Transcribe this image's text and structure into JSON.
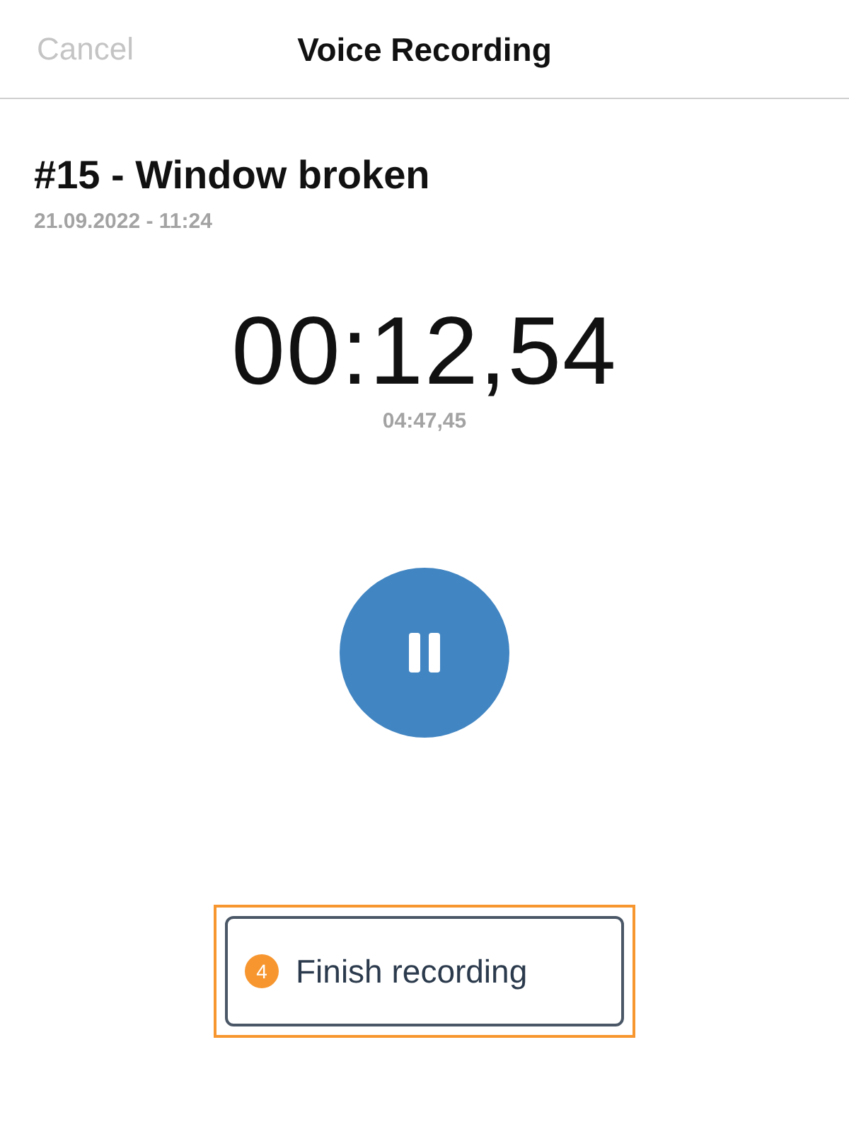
{
  "header": {
    "cancel": "Cancel",
    "title": "Voice Recording"
  },
  "ticket": {
    "title": "#15 - Window broken",
    "date": "21.09.2022 - 11:24"
  },
  "timer": {
    "elapsed": "00:12,54",
    "remaining": "04:47,45"
  },
  "finish_button": {
    "label": "Finish recording",
    "step_badge": "4"
  }
}
